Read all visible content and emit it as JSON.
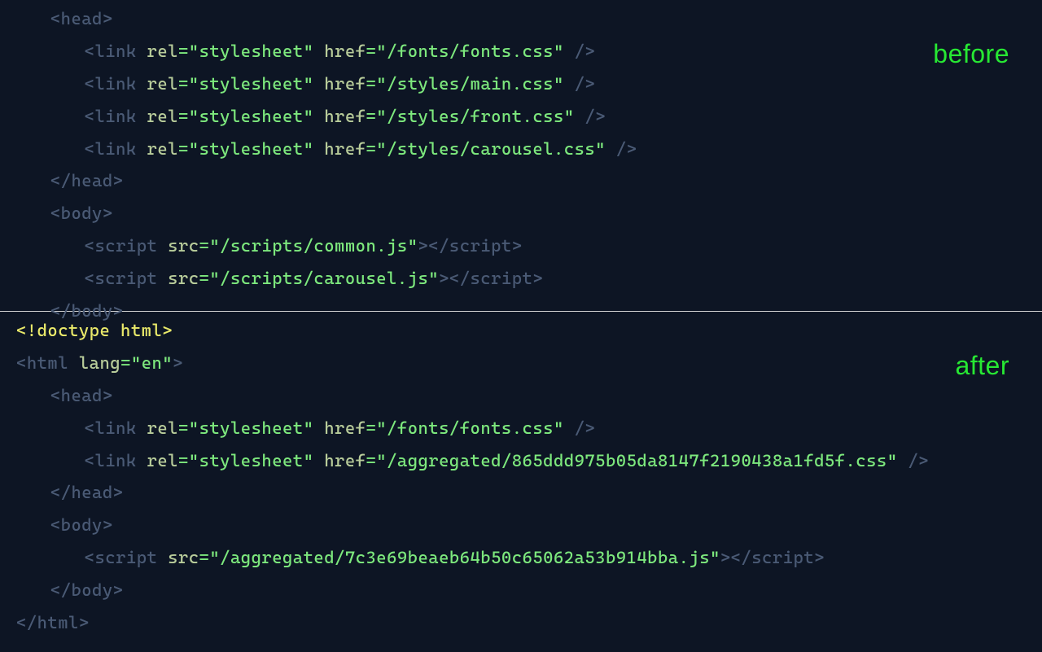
{
  "labels": {
    "before": "before",
    "after": "after"
  },
  "before": {
    "head_open": "head",
    "links": [
      {
        "rel": "stylesheet",
        "href": "/fonts/fonts.css"
      },
      {
        "rel": "stylesheet",
        "href": "/styles/main.css"
      },
      {
        "rel": "stylesheet",
        "href": "/styles/front.css"
      },
      {
        "rel": "stylesheet",
        "href": "/styles/carousel.css"
      }
    ],
    "head_close": "head",
    "body_open": "body",
    "scripts": [
      {
        "src": "/scripts/common.js"
      },
      {
        "src": "/scripts/carousel.js"
      }
    ],
    "body_close": "body"
  },
  "after": {
    "doctype": "<!doctype html>",
    "html_open_tag": "html",
    "html_lang_attr": "lang",
    "html_lang_val": "en",
    "head_open": "head",
    "links": [
      {
        "rel": "stylesheet",
        "href": "/fonts/fonts.css"
      },
      {
        "rel": "stylesheet",
        "href": "/aggregated/865ddd975b05da8147f2190438a1fd5f.css"
      }
    ],
    "head_close": "head",
    "body_open": "body",
    "scripts": [
      {
        "src": "/aggregated/7c3e69beaeb64b50c65062a53b914bba.js"
      }
    ],
    "body_close": "body",
    "html_close": "html"
  }
}
